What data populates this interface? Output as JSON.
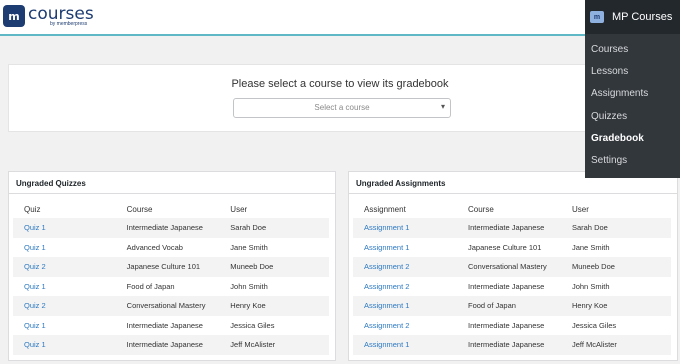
{
  "logo": {
    "badge": "m",
    "word": "courses",
    "sub": "by memberpress"
  },
  "select_card": {
    "title": "Please select a course to view its gradebook",
    "placeholder": "Select a course"
  },
  "quizzes_panel": {
    "title": "Ungraded Quizzes",
    "headers": [
      "Quiz",
      "Course",
      "User"
    ],
    "rows": [
      [
        "Quiz 1",
        "Intermediate Japanese",
        "Sarah Doe"
      ],
      [
        "Quiz 1",
        "Advanced Vocab",
        "Jane Smith"
      ],
      [
        "Quiz 2",
        "Japanese Culture 101",
        "Muneeb Doe"
      ],
      [
        "Quiz 1",
        "Food of Japan",
        "John Smith"
      ],
      [
        "Quiz 2",
        "Conversational Mastery",
        "Henry Koe"
      ],
      [
        "Quiz 1",
        "Intermediate Japanese",
        "Jessica Giles"
      ],
      [
        "Quiz 1",
        "Intermediate Japanese",
        "Jeff McAlister"
      ]
    ]
  },
  "assignments_panel": {
    "title": "Ungraded Assignments",
    "headers": [
      "Assignment",
      "Course",
      "User"
    ],
    "rows": [
      [
        "Assignment 1",
        "Intermediate Japanese",
        "Sarah Doe"
      ],
      [
        "Assignment 1",
        "Japanese Culture 101",
        "Jane Smith"
      ],
      [
        "Assignment 2",
        "Conversational Mastery",
        "Muneeb Doe"
      ],
      [
        "Assignment 2",
        "Intermediate Japanese",
        "John Smith"
      ],
      [
        "Assignment 1",
        "Food of Japan",
        "Henry Koe"
      ],
      [
        "Assignment 2",
        "Intermediate Japanese",
        "Jessica Giles"
      ],
      [
        "Assignment 1",
        "Intermediate Japanese",
        "Jeff McAlister"
      ]
    ]
  },
  "mp_menu": {
    "title": "MP Courses",
    "icon": "m",
    "items": [
      "Courses",
      "Lessons",
      "Assignments",
      "Quizzes",
      "Gradebook",
      "Settings"
    ],
    "active": "Gradebook"
  },
  "colors": {
    "link": "#2b78c2",
    "menu_bg": "#23282d",
    "accent_line": "#5fb8c6",
    "brand": "#1d3c72"
  }
}
